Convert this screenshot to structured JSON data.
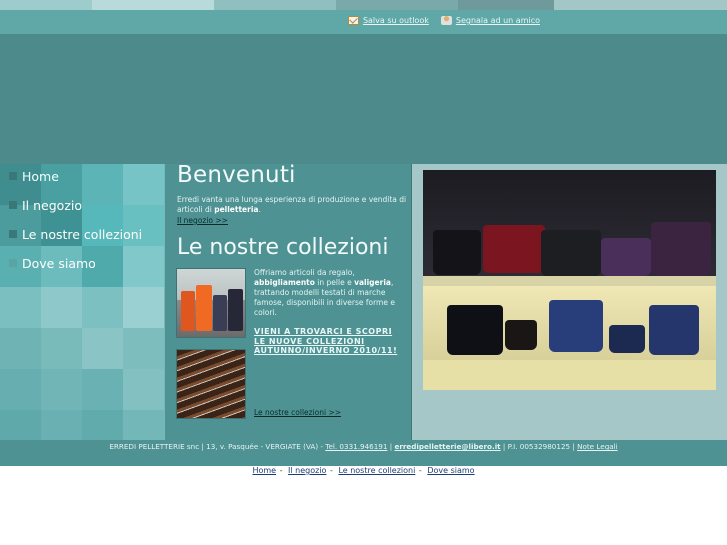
{
  "top_links": {
    "outlook": "Salva su outlook",
    "friend": "Segnala ad un amico"
  },
  "nav": {
    "items": [
      {
        "label": "Home"
      },
      {
        "label": "Il negozio"
      },
      {
        "label": "Le nostre collezioni"
      },
      {
        "label": "Dove siamo"
      }
    ]
  },
  "welcome": {
    "title": "Benvenuti",
    "text_start": "Erredi vanta una lunga esperienza di produzione e vendita di articoli di ",
    "text_bold": "pelletteria",
    "text_end": ".",
    "link": "Il negozio >>"
  },
  "collections": {
    "title": "Le nostre collezioni",
    "text_a": "Offriamo articoli da regalo,",
    "text_bold1": "abbigliamento",
    "text_b": " in pelle e ",
    "text_bold2": "valigeria",
    "text_c": ", trattando modelli testati di marche famose, disponibili in diverse forme e colori.",
    "promo": "VIENI A TROVARCI E SCOPRI LE NUOVE COLLEZIONI AUTUNNO/INVERNO 2010/11!",
    "link": "Le nostre collezioni >>"
  },
  "footer": {
    "company": "ERREDI PELLETTERIE snc | 13, v. Pasquée - VERGIATE (VA) - ",
    "phone": "Tel. 0331.946191",
    "sep1": " | ",
    "email": "erredipelletterie@libero.it",
    "vat": " | P.I. 00532980125 | ",
    "legal": "Note Legali"
  },
  "bottom_nav": {
    "home": "Home",
    "negozio": "Il negozio",
    "collezioni": "Le nostre collezioni",
    "dove": "Dove siamo",
    "sep": "-"
  },
  "colors": {
    "header": "#4c8a8b",
    "topbar": "#60a7a8",
    "main": "#4e9293",
    "photo_bg": "#a6c7c8"
  }
}
